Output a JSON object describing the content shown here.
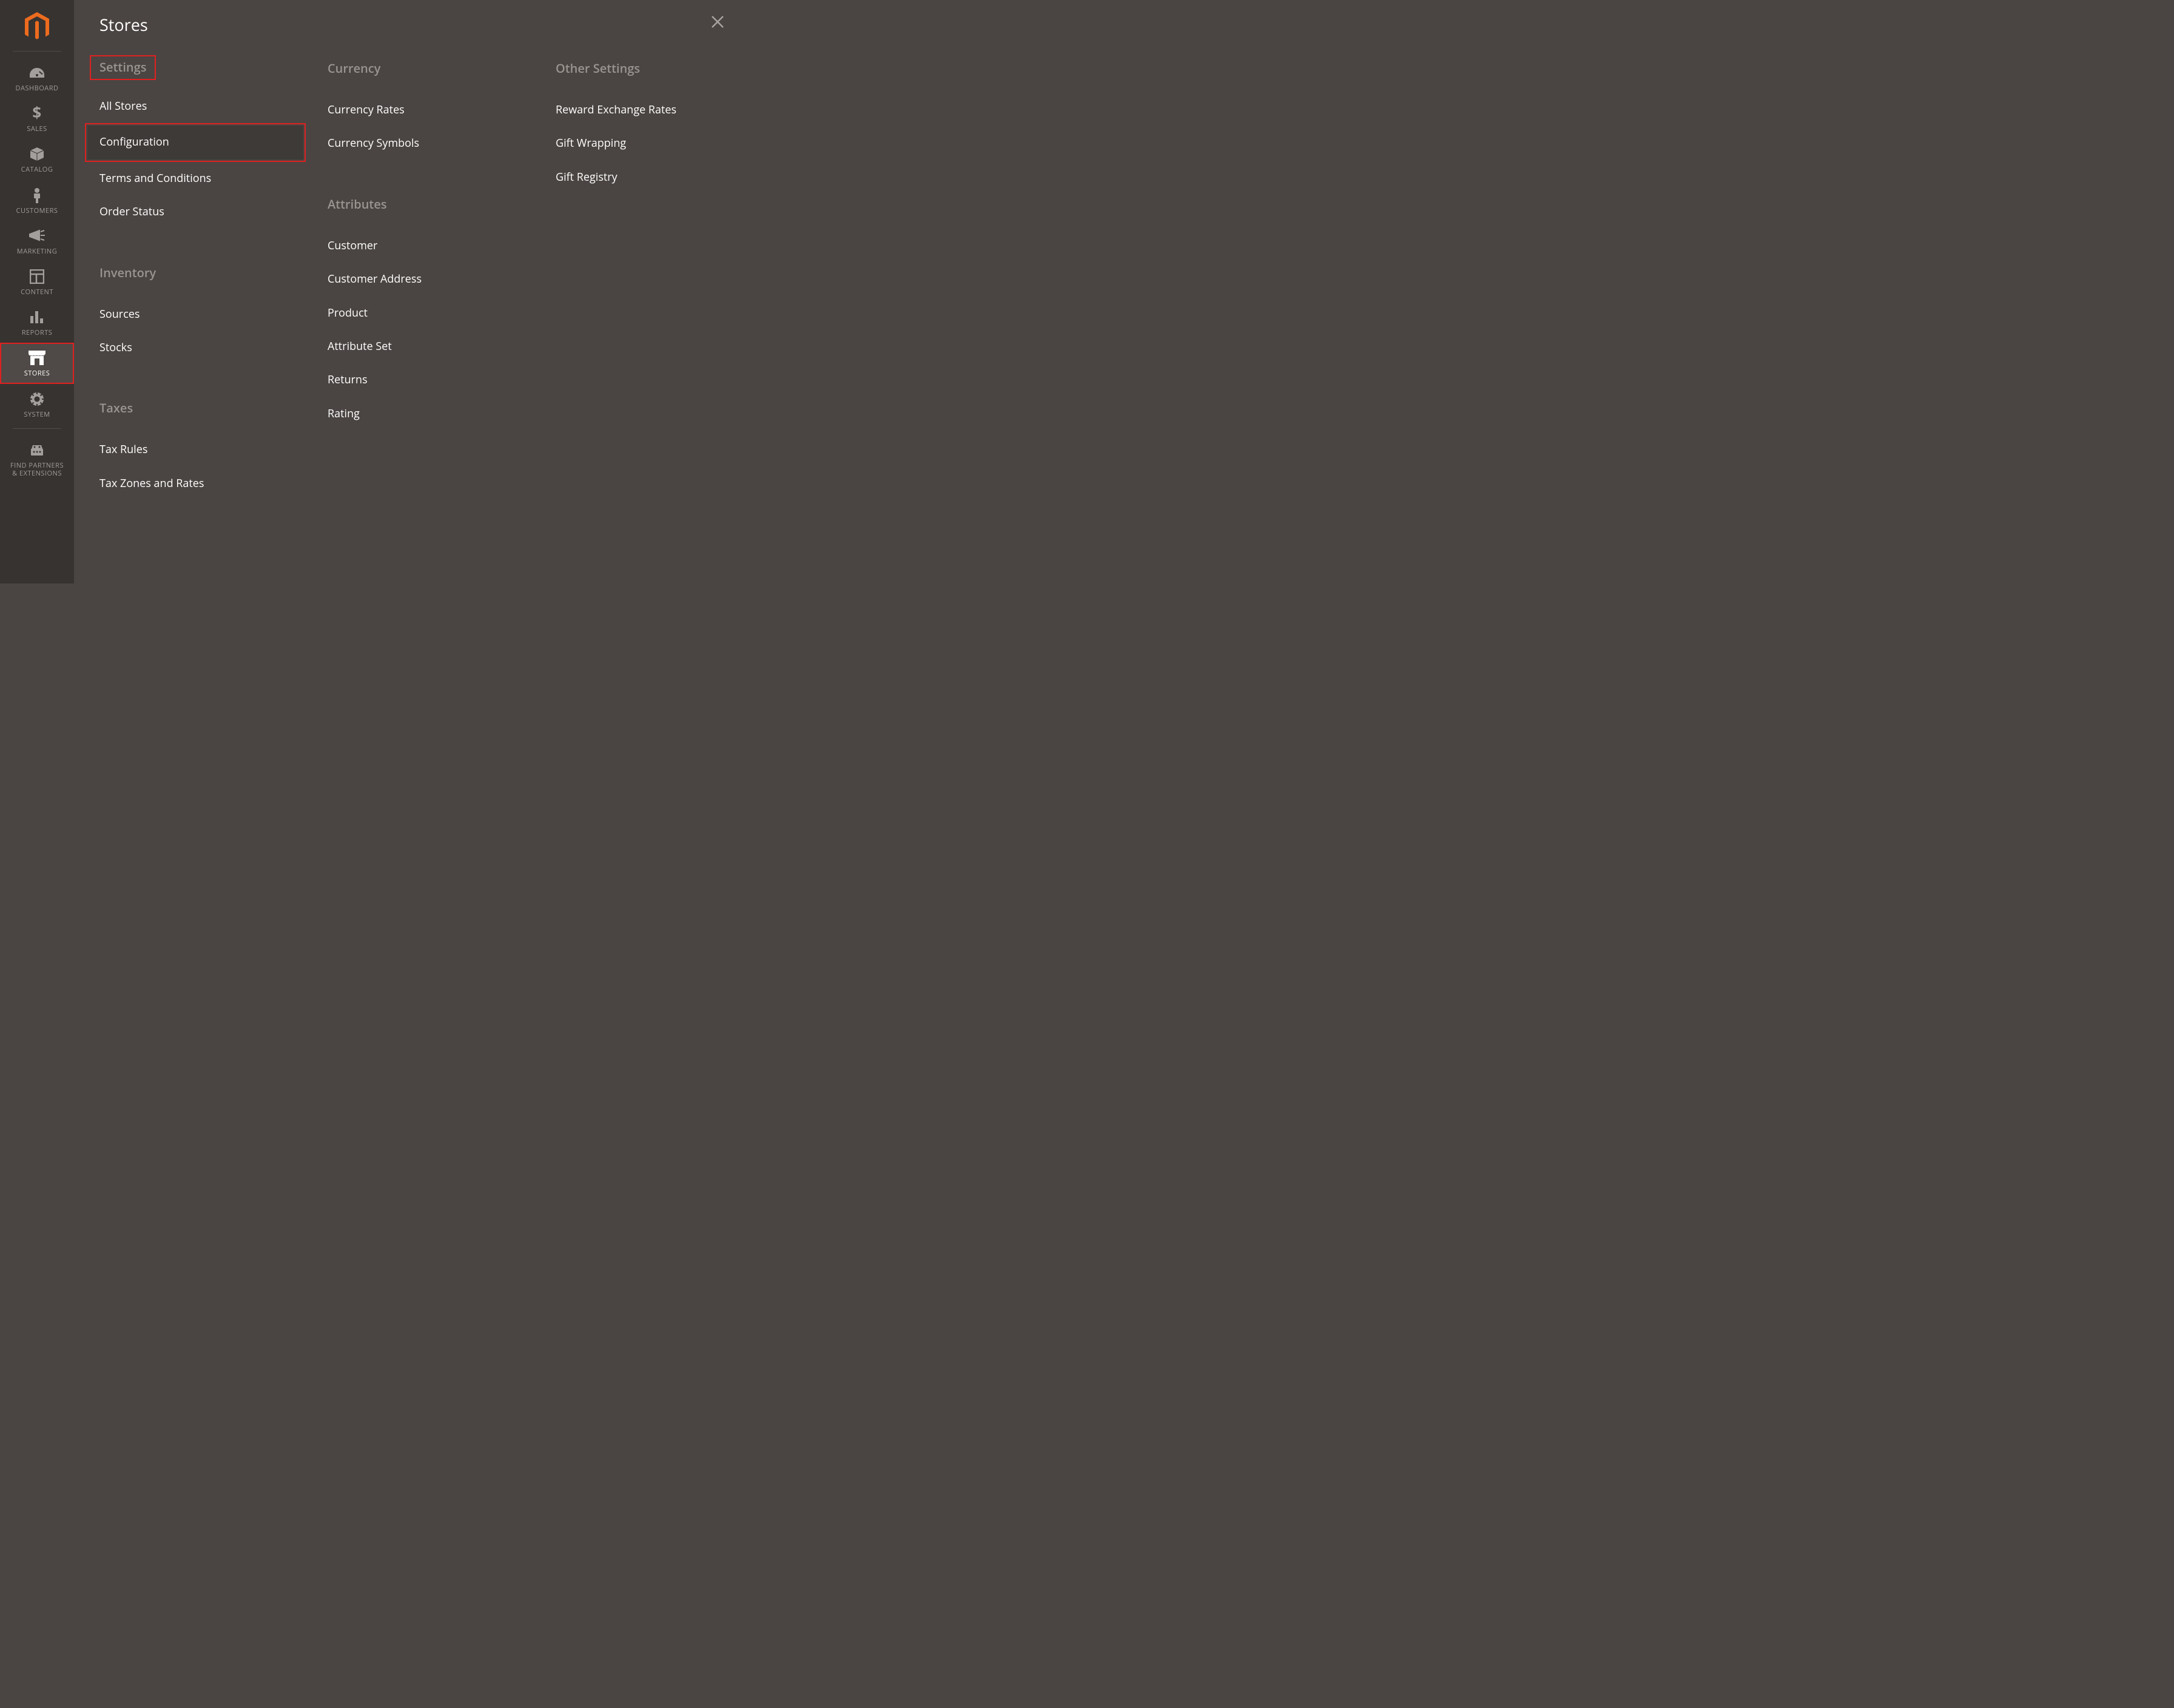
{
  "sidebar": {
    "items": [
      {
        "id": "dashboard",
        "label": "DASHBOARD",
        "icon": "dashboard-icon"
      },
      {
        "id": "sales",
        "label": "SALES",
        "icon": "sales-icon"
      },
      {
        "id": "catalog",
        "label": "CATALOG",
        "icon": "catalog-icon"
      },
      {
        "id": "customers",
        "label": "CUSTOMERS",
        "icon": "customers-icon"
      },
      {
        "id": "marketing",
        "label": "MARKETING",
        "icon": "marketing-icon"
      },
      {
        "id": "content",
        "label": "CONTENT",
        "icon": "content-icon"
      },
      {
        "id": "reports",
        "label": "REPORTS",
        "icon": "reports-icon"
      },
      {
        "id": "stores",
        "label": "STORES",
        "icon": "stores-icon",
        "active": true,
        "highlighted": true
      },
      {
        "id": "system",
        "label": "SYSTEM",
        "icon": "system-icon"
      },
      {
        "id": "partners",
        "label": "FIND PARTNERS\n& EXTENSIONS",
        "icon": "partners-icon"
      }
    ]
  },
  "flyout": {
    "title": "Stores",
    "columns": [
      {
        "groups": [
          {
            "title": "Settings",
            "highlighted": true,
            "items": [
              {
                "label": "All Stores"
              },
              {
                "label": "Configuration",
                "hovered": true,
                "highlighted": true
              },
              {
                "label": "Terms and Conditions"
              },
              {
                "label": "Order Status"
              }
            ]
          },
          {
            "title": "Inventory",
            "items": [
              {
                "label": "Sources"
              },
              {
                "label": "Stocks"
              }
            ]
          },
          {
            "title": "Taxes",
            "items": [
              {
                "label": "Tax Rules"
              },
              {
                "label": "Tax Zones and Rates"
              }
            ]
          }
        ]
      },
      {
        "groups": [
          {
            "title": "Currency",
            "items": [
              {
                "label": "Currency Rates"
              },
              {
                "label": "Currency Symbols"
              }
            ]
          },
          {
            "title": "Attributes",
            "items": [
              {
                "label": "Customer"
              },
              {
                "label": "Customer Address"
              },
              {
                "label": "Product"
              },
              {
                "label": "Attribute Set"
              },
              {
                "label": "Returns"
              },
              {
                "label": "Rating"
              }
            ]
          }
        ]
      },
      {
        "groups": [
          {
            "title": "Other Settings",
            "items": [
              {
                "label": "Reward Exchange Rates"
              },
              {
                "label": "Gift Wrapping"
              },
              {
                "label": "Gift Registry"
              }
            ]
          }
        ]
      }
    ]
  }
}
